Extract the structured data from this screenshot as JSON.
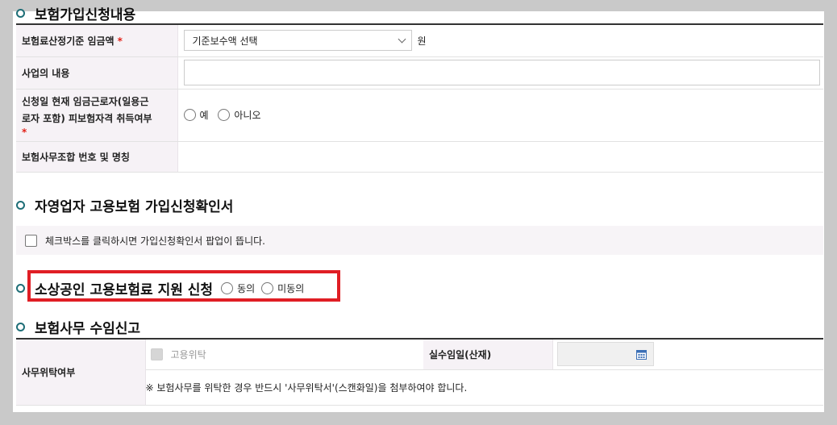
{
  "section1": {
    "title": "보험가입신청내용",
    "rows": {
      "wage": {
        "label": "보험료산정기준 임금액",
        "required": "*",
        "select_value": "기준보수액 선택",
        "unit": "원"
      },
      "business": {
        "label": "사업의 내용"
      },
      "qualification": {
        "label_line1": "신청일 현재 임금근로자(일용근",
        "label_line2": "로자 포함) 피보험자격 취득여부",
        "required": "*",
        "options": [
          "예",
          "아니오"
        ]
      },
      "office": {
        "label": "보험사무조합 번호 및 명칭"
      }
    }
  },
  "section2": {
    "title": "자영업자 고용보험 가입신청확인서",
    "checkbox_text": "체크박스를 클릭하시면 가입신청확인서 팝업이 뜹니다."
  },
  "section3": {
    "title": "소상공인 고용보험료 지원 신청",
    "options": [
      "동의",
      "미동의"
    ]
  },
  "section4": {
    "title": "보험사무 수임신고",
    "row_label": "사무위탁여부",
    "checkbox_label": "고용위탁",
    "date_label": "실수임일(산재)",
    "note": "※ 보험사무를 위탁한 경우 반드시 '사무위탁서'(스캔화일)을 첨부하여야 합니다."
  },
  "colors": {
    "accent": "#1e6e77",
    "highlight": "#e01e25",
    "required": "#e2231a"
  }
}
